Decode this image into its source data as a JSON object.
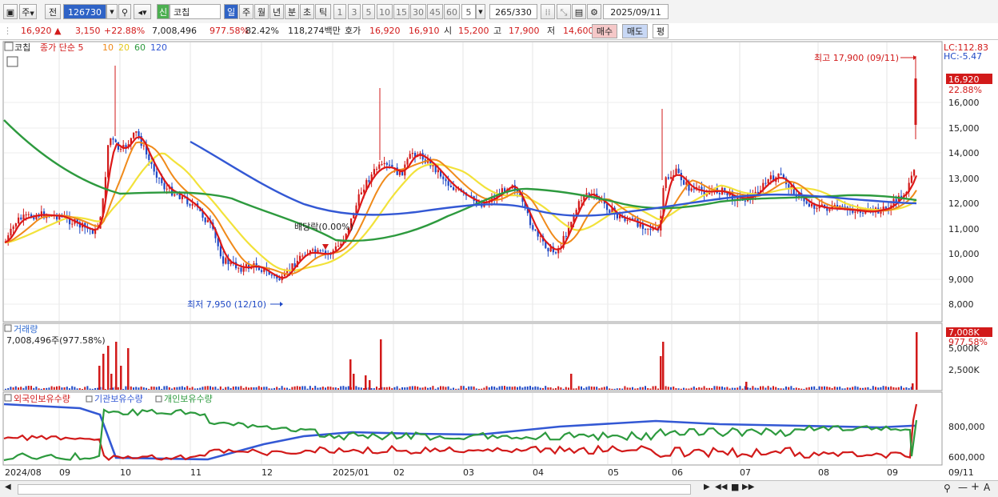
{
  "toolbar": {
    "period_type": "주",
    "prev_label": "전",
    "stock_code": "126730",
    "badge_new": "신",
    "stock_name": "코칩",
    "periods": [
      "일",
      "주",
      "월",
      "년",
      "분",
      "초",
      "틱"
    ],
    "active_period": "일",
    "minute_options": [
      "1",
      "3",
      "5",
      "10",
      "15",
      "30",
      "45",
      "60"
    ],
    "count_value": "5",
    "count_ratio": "265/330",
    "date": "2025/09/11"
  },
  "quote": {
    "price": "16,920",
    "change_arrow": "▲",
    "change": "3,150",
    "change_pct": "+22.88%",
    "volume": "7,008,496",
    "vol_ratio": "977.58%",
    "turnover": "82.42%",
    "amount": "118,274백만",
    "ask_label": "호가",
    "ask1": "16,920",
    "ask2": "16,910",
    "open_label": "시",
    "open": "15,200",
    "high_label": "고",
    "high": "17,900",
    "low_label": "저",
    "low": "14,600",
    "buy_label": "매수",
    "sell_label": "매도",
    "avg_label": "평"
  },
  "price_panel": {
    "name": "코칩",
    "legend": "종가 단순 5",
    "ma_periods": [
      "10",
      "20",
      "60",
      "120"
    ],
    "lc": "LC:112.83",
    "hc": "HC:-5.47",
    "y_ticks": [
      "16,000",
      "15,000",
      "14,000",
      "13,000",
      "12,000",
      "11,000",
      "10,000",
      "9,000",
      "8,000"
    ],
    "current_tag": "16,920",
    "current_pct": "22.88%",
    "max_label": "최고 17,900 (09/11)",
    "min_label": "최저 7,950 (12/10)",
    "dividend_label": "배당락(0.00%)"
  },
  "volume_panel": {
    "title": "거래량",
    "info": "7,008,496주(977.58%)",
    "y_ticks": [
      "5,000K",
      "2,500K"
    ],
    "current_tag": "7,008K",
    "current_pct": "977.58%"
  },
  "holdings_panel": {
    "legend": [
      "외국인보유수량",
      "기관보유수량",
      "개인보유수량"
    ],
    "y_ticks": [
      "800,000",
      "600,000"
    ]
  },
  "x_axis": {
    "labels": [
      "2024/08",
      "09",
      "10",
      "11",
      "12",
      "2025/01",
      "02",
      "03",
      "04",
      "05",
      "06",
      "07",
      "08",
      "09",
      "09/11"
    ]
  },
  "colors": {
    "up": "#d21a1a",
    "down": "#1f49c6",
    "ma5": "#dd1818",
    "ma10": "#f08a1a",
    "ma20": "#f2e23a",
    "ma60": "#2d9a3e",
    "ma120": "#3358d4"
  }
}
